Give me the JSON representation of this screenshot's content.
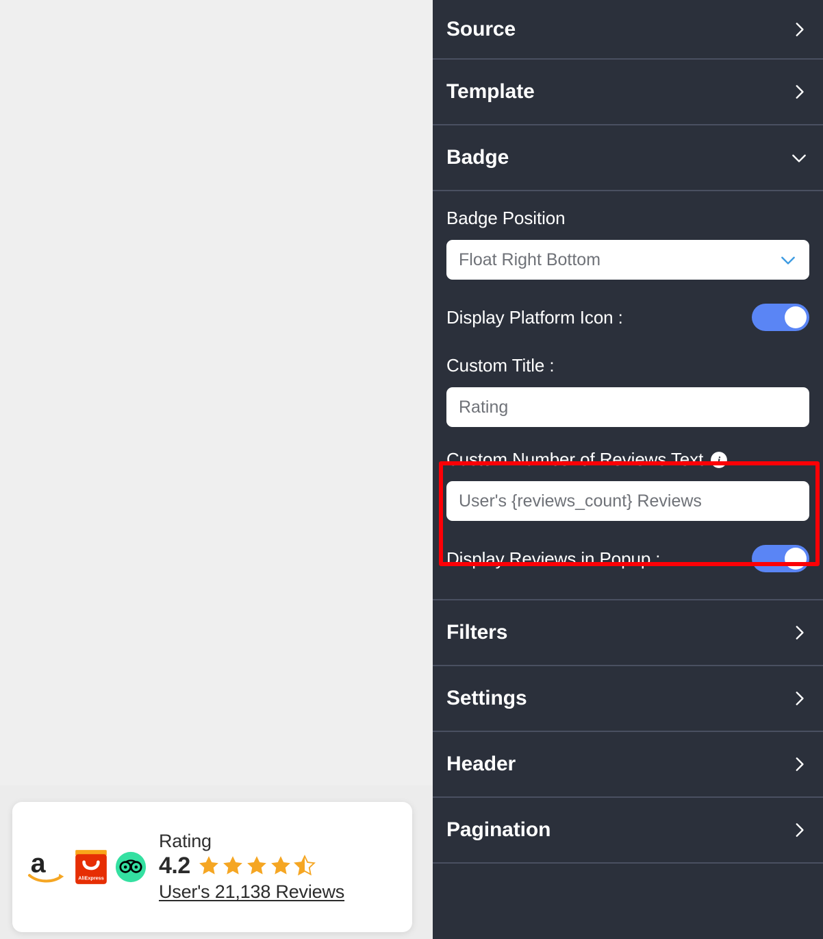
{
  "preview": {
    "badge_card": {
      "platforms": [
        {
          "name": "amazon",
          "icon": "amazon-icon"
        },
        {
          "name": "aliexpress",
          "icon": "aliexpress-icon",
          "wordmark": "AliExpress"
        },
        {
          "name": "tripadvisor",
          "icon": "tripadvisor-icon"
        }
      ],
      "title": "Rating",
      "rating_value": "4.2",
      "stars_filled": 4.5,
      "stars_total": 5,
      "star_color": "#f5a623",
      "reviews_text": "User's 21,138 Reviews"
    }
  },
  "panel": {
    "sections": [
      {
        "label": "Source",
        "state": "collapsed",
        "icon": "chevron-right-icon"
      },
      {
        "label": "Template",
        "state": "collapsed",
        "icon": "chevron-right-icon"
      },
      {
        "label": "Badge",
        "state": "expanded",
        "icon": "chevron-down-icon"
      },
      {
        "label": "Filters",
        "state": "collapsed",
        "icon": "chevron-right-icon"
      },
      {
        "label": "Settings",
        "state": "collapsed",
        "icon": "chevron-right-icon"
      },
      {
        "label": "Header",
        "state": "collapsed",
        "icon": "chevron-right-icon"
      },
      {
        "label": "Pagination",
        "state": "collapsed",
        "icon": "chevron-right-icon"
      }
    ],
    "badge_section": {
      "badge_position_label": "Badge Position",
      "badge_position_value": "Float Right Bottom",
      "display_platform_icon_label": "Display Platform Icon :",
      "display_platform_icon_on": true,
      "custom_title_label": "Custom Title :",
      "custom_title_placeholder": "Rating",
      "custom_reviews_text_label": "Custom Number of Reviews Text",
      "custom_reviews_text_placeholder": "User's {reviews_count} Reviews",
      "display_reviews_popup_label": "Display Reviews in Popup :",
      "display_reviews_popup_on": true
    }
  },
  "colors": {
    "panel_bg": "#2b303b",
    "divider": "#4a5061",
    "toggle_on": "#5a85f5",
    "select_chevron": "#3b9ae1",
    "highlight": "#fd0006",
    "star": "#f5a623",
    "preview_bg": "#eeeeee"
  }
}
